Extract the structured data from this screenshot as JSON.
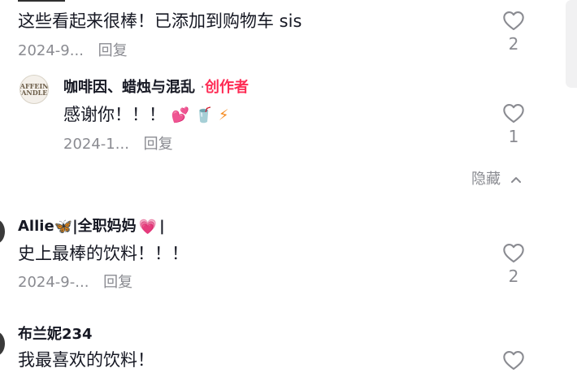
{
  "colors": {
    "accent": "#fe2c55",
    "muted": "#8a8b91",
    "text": "#161823"
  },
  "comments": [
    {
      "text": "这些看起来很棒！已添加到购物车 sis",
      "date": "2024-9...",
      "reply_label": "回复",
      "likes": "2",
      "replies": [
        {
          "username": "咖啡因、蜡烛与混乱",
          "separator": "·",
          "badge": "创作者",
          "avatar_text": "CAFFEINE CANDLES",
          "text": "感谢你！！！",
          "emojis": [
            "💕",
            "🥤",
            "⚡"
          ],
          "date": "2024-1...",
          "reply_label": "回复",
          "likes": "1"
        }
      ],
      "collapse_label": "隐藏"
    },
    {
      "username": "Allie",
      "username_suffix": "|全职妈妈",
      "username_end": "|",
      "emojis": [
        "🦋",
        "💗"
      ],
      "text": "史上最棒的饮料！！！",
      "date": "2024-9-...",
      "reply_label": "回复",
      "likes": "2"
    },
    {
      "username": "布兰妮234",
      "text": "我最喜欢的饮料！"
    }
  ]
}
